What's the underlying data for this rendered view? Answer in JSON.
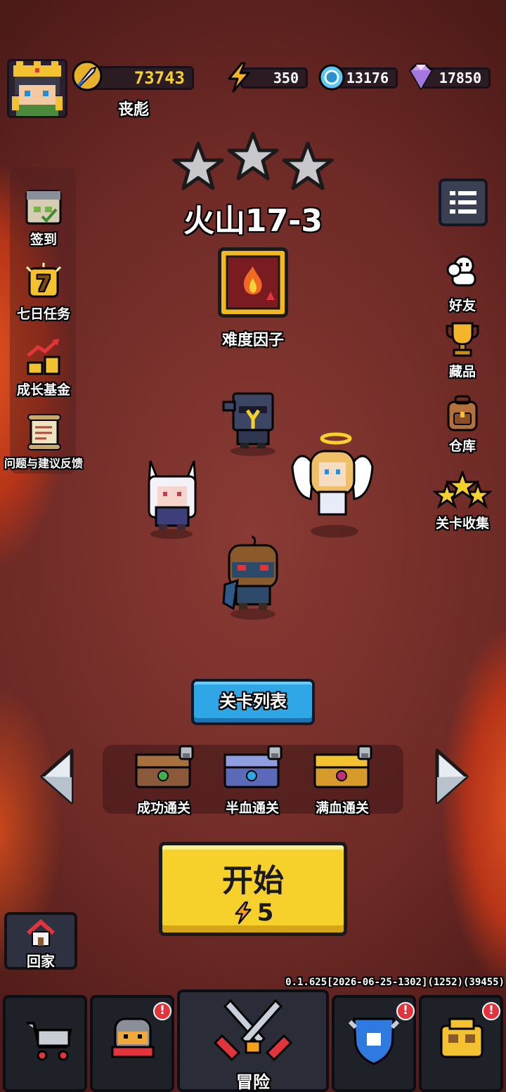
{
  "player": {
    "name": "丧彪",
    "power": "73743"
  },
  "resources": {
    "energy": "350",
    "coins": "13176",
    "gems": "17850"
  },
  "stage": {
    "title": "火山17-3",
    "stars": 3,
    "modifier_label": "难度因子",
    "start_label": "开始",
    "start_cost": "5",
    "list_button": "关卡列表"
  },
  "left_menu": [
    {
      "label": "签到",
      "icon": "calendar-icon"
    },
    {
      "label": "七日任务",
      "icon": "seven-day-icon"
    },
    {
      "label": "成长基金",
      "icon": "gold-stack-icon"
    },
    {
      "label": "问题与建议反馈",
      "icon": "scroll-icon"
    }
  ],
  "right_menu": [
    {
      "label": "好友",
      "icon": "friends-icon"
    },
    {
      "label": "藏品",
      "icon": "trophy-icon"
    },
    {
      "label": "仓库",
      "icon": "backpack-icon"
    },
    {
      "label": "关卡收集",
      "icon": "stars-icon"
    }
  ],
  "rewards": [
    {
      "label": "成功通关",
      "color": "#8b5a3a"
    },
    {
      "label": "半血通关",
      "color": "#5a6ab8"
    },
    {
      "label": "满血通关",
      "color": "#d69b2a"
    }
  ],
  "home_label": "回家",
  "version": "0.1.625[2026-06-25-1302](1252)(39455)",
  "bottom_nav": {
    "adventure_label": "冒险"
  },
  "colors": {
    "accent_yellow": "#f6d12c",
    "accent_blue": "#2fa6e6",
    "badge_red": "#e4343b"
  }
}
